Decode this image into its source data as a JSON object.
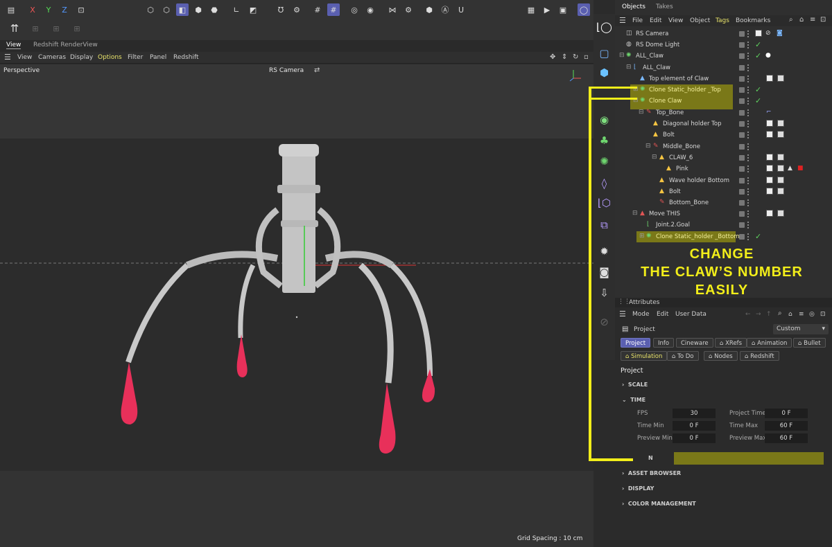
{
  "toolbar": {
    "axis_x": "X",
    "axis_y": "Y",
    "axis_z": "Z"
  },
  "view_tabs": [
    "View",
    "Redshift RenderView"
  ],
  "view_menu": [
    "View",
    "Cameras",
    "Display",
    "Options",
    "Filter",
    "Panel",
    "Redshift"
  ],
  "viewport": {
    "projection": "Perspective",
    "camera": "RS Camera",
    "grid_spacing": "Grid Spacing : 10 cm"
  },
  "objects_panel": {
    "tabs": [
      "Objects",
      "Takes"
    ],
    "menu": [
      "File",
      "Edit",
      "View",
      "Object",
      "Tags",
      "Bookmarks"
    ],
    "rows": [
      {
        "label": "RS Camera"
      },
      {
        "label": "RS Dome Light"
      },
      {
        "label": "ALL_Claw"
      },
      {
        "label": "ALL_Claw"
      },
      {
        "label": "Top element of Claw"
      },
      {
        "label": "Clone Static_holder _Top"
      },
      {
        "label": "Clone Claw"
      },
      {
        "label": "Top_Bone"
      },
      {
        "label": "Diagonal  holder Top"
      },
      {
        "label": "Bolt"
      },
      {
        "label": "Middle_Bone"
      },
      {
        "label": "CLAW_6"
      },
      {
        "label": "Pink"
      },
      {
        "label": "Wave holder Bottom"
      },
      {
        "label": "Bolt"
      },
      {
        "label": "Bottom_Bone"
      },
      {
        "label": "Move THIS"
      },
      {
        "label": "Joint.2.Goal"
      },
      {
        "label": "Clone Static_holder _Bottom"
      }
    ]
  },
  "annotation": {
    "line1": "CHANGE",
    "line2": "THE CLAW’S NUMBER",
    "line3": "EASILY"
  },
  "attributes": {
    "title": "Attributes",
    "menu": [
      "Mode",
      "Edit",
      "User Data"
    ],
    "object": "Project",
    "preset": "Custom",
    "tabs_row1": [
      "Project",
      "Info",
      "Cineware",
      "XRefs",
      "Animation",
      "Bullet"
    ],
    "tabs_row2": [
      "Simulation",
      "To Do",
      "Nodes",
      "Redshift"
    ],
    "section": "Project",
    "groups": {
      "scale": "SCALE",
      "time": "TIME",
      "execution": "N",
      "asset_browser": "ASSET BROWSER",
      "display": "DISPLAY",
      "color_management": "COLOR MANAGEMENT"
    },
    "fields": {
      "fps_label": "FPS",
      "fps": "30",
      "project_time_label": "Project Time",
      "project_time": "0 F",
      "time_min_label": "Time Min",
      "time_min": "0 F",
      "time_max_label": "Time Max",
      "time_max": "60 F",
      "preview_min_label": "Preview Min",
      "preview_min": "0 F",
      "preview_max_label": "Preview Max",
      "preview_max": "60 F"
    }
  },
  "colors": {
    "accent": "#5a5fb0",
    "highlight": "#f2ee1a",
    "claw_tip": "#e8305a"
  }
}
